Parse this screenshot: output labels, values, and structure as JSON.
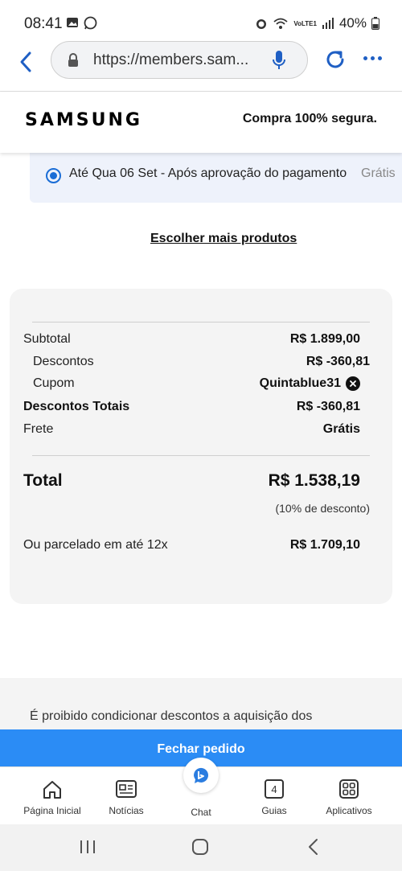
{
  "status_bar": {
    "time": "08:41",
    "battery": "40%",
    "network": "VoLTE1"
  },
  "browser": {
    "url": "https://members.sam..."
  },
  "header": {
    "logo": "SAMSUNG",
    "secure_text": "Compra 100% segura."
  },
  "delivery": {
    "label": "Até Qua 06 Set - Após aprovação do pagamento",
    "price": "Grátis"
  },
  "links": {
    "more_products": "Escolher mais produtos"
  },
  "summary": {
    "subtotal_label": "Subtotal",
    "subtotal_value": "R$ 1.899,00",
    "discounts_label": "Descontos",
    "discounts_value": "R$ -360,81",
    "coupon_label": "Cupom",
    "coupon_value": "Quintablue31",
    "total_discounts_label": "Descontos Totais",
    "total_discounts_value": "R$ -360,81",
    "shipping_label": "Frete",
    "shipping_value": "Grátis",
    "total_label": "Total",
    "total_value": "R$ 1.538,19",
    "discount_note": "(10% de desconto)",
    "installments_label": "Ou parcelado em até 12x",
    "installments_value": "R$ 1.709,10"
  },
  "legal": {
    "text": "É proibido condicionar descontos a aquisição dos"
  },
  "checkout": {
    "button_label": "Fechar pedido"
  },
  "app_nav": {
    "items": [
      {
        "label": "Página Inicial",
        "icon": "home-icon"
      },
      {
        "label": "Notícias",
        "icon": "news-icon"
      },
      {
        "label": "Chat",
        "icon": "bing-chat-icon"
      },
      {
        "label": "Guias",
        "icon": "tabs-icon",
        "badge": "4"
      },
      {
        "label": "Aplicativos",
        "icon": "apps-icon"
      }
    ]
  }
}
